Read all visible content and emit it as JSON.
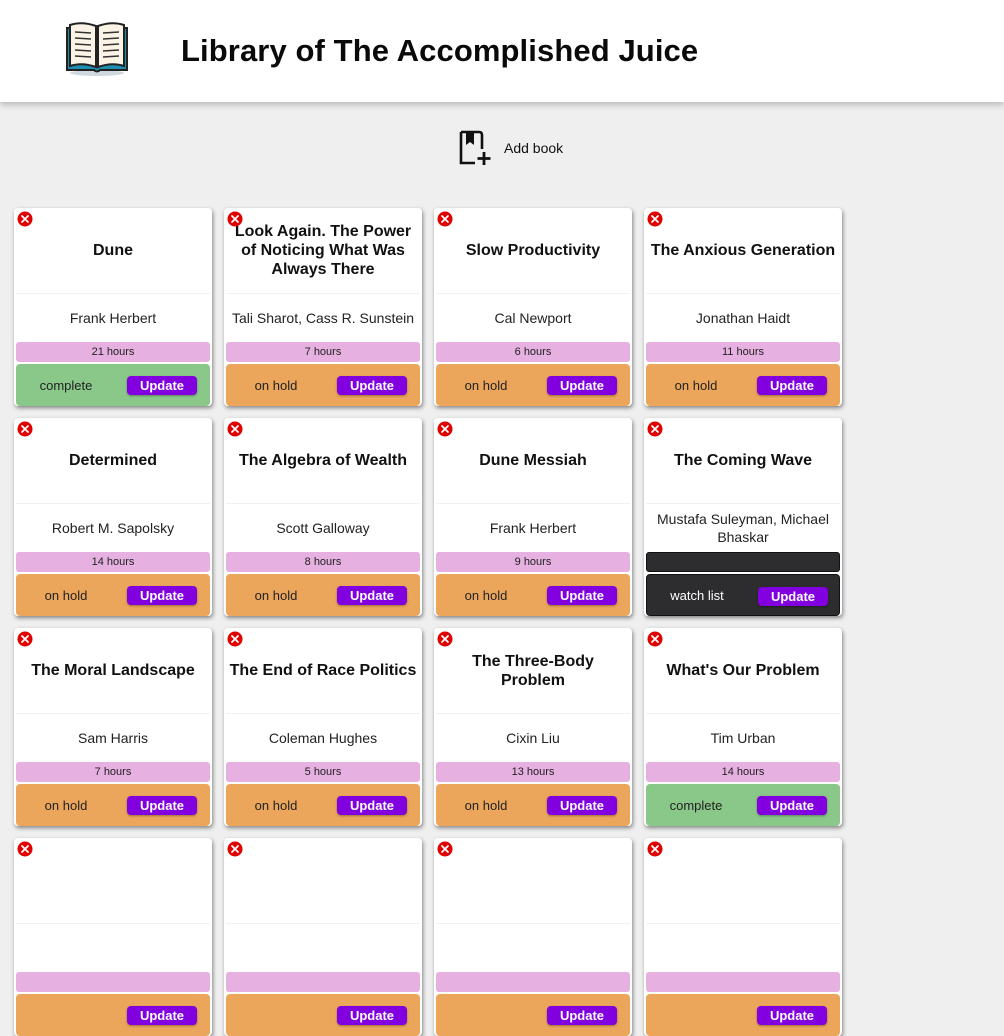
{
  "header": {
    "title": "Library of The Accomplished Juice",
    "logo_icon": "open-book-icon"
  },
  "toolbar": {
    "add_label": "Add book",
    "add_icon": "bookmark-add-icon"
  },
  "colors": {
    "update_button": "#8200e0",
    "hours_bar": "#e6b0e0",
    "complete": "#8ac88a",
    "on_hold": "#eba65c",
    "watch_list": "#2d2d30",
    "delete": "#e00000"
  },
  "update_label": "Update",
  "delete_icon": "close-circle-icon",
  "books": [
    {
      "title": "Dune",
      "author": "Frank Herbert",
      "hours": "21 hours",
      "status": "complete"
    },
    {
      "title": "Look Again. The Power of Noticing What Was Always There",
      "author": "Tali Sharot, Cass R. Sunstein",
      "hours": "7 hours",
      "status": "on hold"
    },
    {
      "title": "Slow Productivity",
      "author": "Cal Newport",
      "hours": "6 hours",
      "status": "on hold"
    },
    {
      "title": "The Anxious Generation",
      "author": "Jonathan Haidt",
      "hours": "11 hours",
      "status": "on hold"
    },
    {
      "title": "Determined",
      "author": "Robert M. Sapolsky",
      "hours": "14 hours",
      "status": "on hold"
    },
    {
      "title": "The Algebra of Wealth",
      "author": "Scott Galloway",
      "hours": "8 hours",
      "status": "on hold"
    },
    {
      "title": "Dune Messiah",
      "author": "Frank Herbert",
      "hours": "9 hours",
      "status": "on hold"
    },
    {
      "title": "The Coming Wave",
      "author": "Mustafa Suleyman, Michael Bhaskar",
      "hours": "",
      "status": "watch list"
    },
    {
      "title": "The Moral Landscape",
      "author": "Sam Harris",
      "hours": "7 hours",
      "status": "on hold"
    },
    {
      "title": "The End of Race Politics",
      "author": "Coleman Hughes",
      "hours": "5 hours",
      "status": "on hold"
    },
    {
      "title": "The Three-Body Problem",
      "author": "Cixin Liu",
      "hours": "13 hours",
      "status": "on hold"
    },
    {
      "title": "What's Our Problem",
      "author": "Tim Urban",
      "hours": "14 hours",
      "status": "complete"
    },
    {
      "title": "",
      "author": "",
      "hours": "",
      "status": ""
    },
    {
      "title": "",
      "author": "",
      "hours": "",
      "status": ""
    },
    {
      "title": "",
      "author": "",
      "hours": "",
      "status": ""
    },
    {
      "title": "",
      "author": "",
      "hours": "",
      "status": ""
    }
  ]
}
